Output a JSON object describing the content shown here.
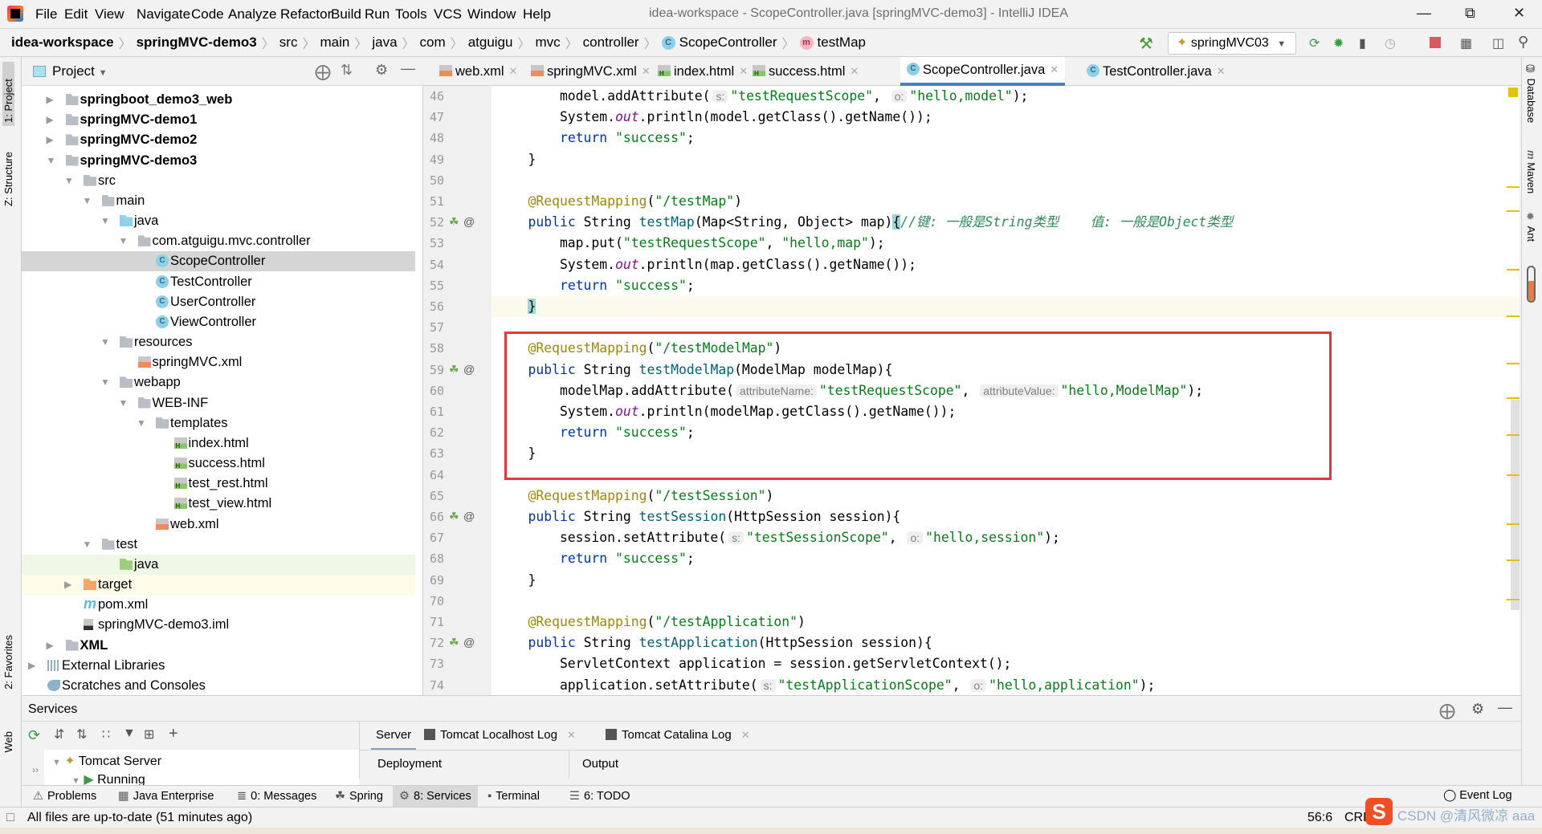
{
  "app": {
    "title": "idea-workspace - ScopeController.java [springMVC-demo3] - IntelliJ IDEA"
  },
  "menu": [
    "File",
    "Edit",
    "View",
    "Navigate",
    "Code",
    "Analyze",
    "Refactor",
    "Build",
    "Run",
    "Tools",
    "VCS",
    "Window",
    "Help"
  ],
  "breadcrumb": [
    "idea-workspace",
    "springMVC-demo3",
    "src",
    "main",
    "java",
    "com",
    "atguigu",
    "mvc",
    "controller",
    "ScopeController",
    "testMap"
  ],
  "run_config": "springMVC03",
  "project_panel": {
    "title": "Project",
    "tree": [
      {
        "label": "springboot_demo3_web",
        "depth": 1,
        "arrow": "collapsed",
        "icon": "module",
        "bold": true
      },
      {
        "label": "springMVC-demo1",
        "depth": 1,
        "arrow": "collapsed",
        "icon": "module",
        "bold": true
      },
      {
        "label": "springMVC-demo2",
        "depth": 1,
        "arrow": "collapsed",
        "icon": "module",
        "bold": true
      },
      {
        "label": "springMVC-demo3",
        "depth": 1,
        "arrow": "expanded",
        "icon": "module",
        "bold": true
      },
      {
        "label": "src",
        "depth": 2,
        "arrow": "expanded",
        "icon": "folder"
      },
      {
        "label": "main",
        "depth": 3,
        "arrow": "expanded",
        "icon": "folder"
      },
      {
        "label": "java",
        "depth": 4,
        "arrow": "expanded",
        "icon": "source-folder"
      },
      {
        "label": "com.atguigu.mvc.controller",
        "depth": 5,
        "arrow": "expanded",
        "icon": "package"
      },
      {
        "label": "ScopeController",
        "depth": 6,
        "icon": "class",
        "selected": true
      },
      {
        "label": "TestController",
        "depth": 6,
        "icon": "class"
      },
      {
        "label": "UserController",
        "depth": 6,
        "icon": "class"
      },
      {
        "label": "ViewController",
        "depth": 6,
        "icon": "class"
      },
      {
        "label": "resources",
        "depth": 4,
        "arrow": "expanded",
        "icon": "resources-folder"
      },
      {
        "label": "springMVC.xml",
        "depth": 5,
        "icon": "spring-xml"
      },
      {
        "label": "webapp",
        "depth": 4,
        "arrow": "expanded",
        "icon": "web-folder"
      },
      {
        "label": "WEB-INF",
        "depth": 5,
        "arrow": "expanded",
        "icon": "folder"
      },
      {
        "label": "templates",
        "depth": 6,
        "arrow": "expanded",
        "icon": "folder"
      },
      {
        "label": "index.html",
        "depth": 7,
        "icon": "html"
      },
      {
        "label": "success.html",
        "depth": 7,
        "icon": "html"
      },
      {
        "label": "test_rest.html",
        "depth": 7,
        "icon": "html"
      },
      {
        "label": "test_view.html",
        "depth": 7,
        "icon": "html"
      },
      {
        "label": "web.xml",
        "depth": 6,
        "icon": "xml"
      },
      {
        "label": "test",
        "depth": 3,
        "arrow": "expanded",
        "icon": "folder"
      },
      {
        "label": "java",
        "depth": 4,
        "icon": "test-folder",
        "highlight": "green"
      },
      {
        "label": "target",
        "depth": 2,
        "arrow": "collapsed",
        "icon": "excluded-folder",
        "highlight": "yellow"
      },
      {
        "label": "pom.xml",
        "depth": 2,
        "icon": "maven"
      },
      {
        "label": "springMVC-demo3.iml",
        "depth": 2,
        "icon": "iml"
      },
      {
        "label": "XML",
        "depth": 1,
        "arrow": "collapsed",
        "icon": "module",
        "bold": true
      },
      {
        "label": "External Libraries",
        "depth": 0,
        "arrow": "collapsed",
        "icon": "libraries"
      },
      {
        "label": "Scratches and Consoles",
        "depth": 0,
        "icon": "scratches"
      }
    ]
  },
  "left_strip": [
    "1: Project",
    "Z: Structure",
    "2: Favorites",
    "Web"
  ],
  "right_strip": [
    "Database",
    "Maven",
    "Ant"
  ],
  "editor_tabs": [
    {
      "label": "web.xml",
      "icon": "xml"
    },
    {
      "label": "springMVC.xml",
      "icon": "spring-xml"
    },
    {
      "label": "index.html",
      "icon": "html"
    },
    {
      "label": "success.html",
      "icon": "html"
    },
    {
      "label": "ScopeController.java",
      "icon": "class",
      "active": true
    },
    {
      "label": "TestController.java",
      "icon": "class"
    }
  ],
  "code": {
    "current_line": 56,
    "lines": [
      {
        "n": 46,
        "t": [
          [
            "        model.addAttribute(",
            ""
          ],
          [
            "s:",
            "hint"
          ],
          [
            "\"testRequestScope\"",
            "str"
          ],
          [
            ", ",
            ""
          ],
          [
            "o:",
            "hint"
          ],
          [
            "\"hello,model\"",
            "str"
          ],
          [
            ");",
            ""
          ]
        ]
      },
      {
        "n": 47,
        "t": [
          [
            "        System.",
            ""
          ],
          [
            "out",
            "fld"
          ],
          [
            ".println(model.getClass().getName());",
            ""
          ]
        ]
      },
      {
        "n": 48,
        "t": [
          [
            "        ",
            ""
          ],
          [
            "return ",
            "kw"
          ],
          [
            "\"success\"",
            "str"
          ],
          [
            ";",
            ""
          ]
        ]
      },
      {
        "n": 49,
        "t": [
          [
            "    }",
            ""
          ]
        ]
      },
      {
        "n": 50,
        "t": []
      },
      {
        "n": 51,
        "t": [
          [
            "    ",
            ""
          ],
          [
            "@RequestMapping",
            "ann"
          ],
          [
            "(",
            ""
          ],
          [
            "\"/testMap\"",
            "str"
          ],
          [
            ")",
            ""
          ]
        ]
      },
      {
        "n": 52,
        "g": true,
        "t": [
          [
            "    ",
            ""
          ],
          [
            "public ",
            "kw"
          ],
          [
            "String ",
            ""
          ],
          [
            "testMap",
            "fn"
          ],
          [
            "(Map<String, Object> map)",
            ""
          ],
          [
            "{",
            "brace"
          ],
          [
            "//键: 一般是String类型    值: 一般是Object类型",
            "cmtg"
          ]
        ]
      },
      {
        "n": 53,
        "t": [
          [
            "        map.put(",
            ""
          ],
          [
            "\"testRequestScope\"",
            "str"
          ],
          [
            ", ",
            ""
          ],
          [
            "\"hello,map\"",
            "str"
          ],
          [
            ");",
            ""
          ]
        ]
      },
      {
        "n": 54,
        "t": [
          [
            "        System.",
            ""
          ],
          [
            "out",
            "fld"
          ],
          [
            ".println(map.getClass().getName());",
            ""
          ]
        ]
      },
      {
        "n": 55,
        "t": [
          [
            "        ",
            ""
          ],
          [
            "return ",
            "kw"
          ],
          [
            "\"success\"",
            "str"
          ],
          [
            ";",
            ""
          ]
        ]
      },
      {
        "n": 56,
        "t": [
          [
            "    ",
            ""
          ],
          [
            "}",
            "brace"
          ]
        ]
      },
      {
        "n": 57,
        "t": []
      },
      {
        "n": 58,
        "t": [
          [
            "    ",
            ""
          ],
          [
            "@RequestMapping",
            "ann"
          ],
          [
            "(",
            ""
          ],
          [
            "\"/testModelMap\"",
            "str"
          ],
          [
            ")",
            ""
          ]
        ]
      },
      {
        "n": 59,
        "g": true,
        "t": [
          [
            "    ",
            ""
          ],
          [
            "public ",
            "kw"
          ],
          [
            "String ",
            ""
          ],
          [
            "testModelMap",
            "fn"
          ],
          [
            "(ModelMap modelMap){",
            ""
          ]
        ]
      },
      {
        "n": 60,
        "t": [
          [
            "        modelMap.addAttribute(",
            ""
          ],
          [
            "attributeName:",
            "hint"
          ],
          [
            "\"testRequestScope\"",
            "str"
          ],
          [
            ", ",
            ""
          ],
          [
            "attributeValue:",
            "hint"
          ],
          [
            "\"hello,ModelMap\"",
            "str"
          ],
          [
            ");",
            ""
          ]
        ]
      },
      {
        "n": 61,
        "t": [
          [
            "        System.",
            ""
          ],
          [
            "out",
            "fld"
          ],
          [
            ".println(modelMap.getClass().getName());",
            ""
          ]
        ]
      },
      {
        "n": 62,
        "t": [
          [
            "        ",
            ""
          ],
          [
            "return ",
            "kw"
          ],
          [
            "\"success\"",
            "str"
          ],
          [
            ";",
            ""
          ]
        ]
      },
      {
        "n": 63,
        "t": [
          [
            "    }",
            ""
          ]
        ]
      },
      {
        "n": 64,
        "t": []
      },
      {
        "n": 65,
        "t": [
          [
            "    ",
            ""
          ],
          [
            "@RequestMapping",
            "ann"
          ],
          [
            "(",
            ""
          ],
          [
            "\"/testSession\"",
            "str"
          ],
          [
            ")",
            ""
          ]
        ]
      },
      {
        "n": 66,
        "g": true,
        "t": [
          [
            "    ",
            ""
          ],
          [
            "public ",
            "kw"
          ],
          [
            "String ",
            ""
          ],
          [
            "testSession",
            "fn"
          ],
          [
            "(HttpSession session){",
            ""
          ]
        ]
      },
      {
        "n": 67,
        "t": [
          [
            "        session.setAttribute(",
            ""
          ],
          [
            "s:",
            "hint"
          ],
          [
            "\"testSessionScope\"",
            "str"
          ],
          [
            ", ",
            ""
          ],
          [
            "o:",
            "hint"
          ],
          [
            "\"hello,session\"",
            "str"
          ],
          [
            ");",
            ""
          ]
        ]
      },
      {
        "n": 68,
        "t": [
          [
            "        ",
            ""
          ],
          [
            "return ",
            "kw"
          ],
          [
            "\"success\"",
            "str"
          ],
          [
            ";",
            ""
          ]
        ]
      },
      {
        "n": 69,
        "t": [
          [
            "    }",
            ""
          ]
        ]
      },
      {
        "n": 70,
        "t": []
      },
      {
        "n": 71,
        "t": [
          [
            "    ",
            ""
          ],
          [
            "@RequestMapping",
            "ann"
          ],
          [
            "(",
            ""
          ],
          [
            "\"/testApplication\"",
            "str"
          ],
          [
            ")",
            ""
          ]
        ]
      },
      {
        "n": 72,
        "g": true,
        "t": [
          [
            "    ",
            ""
          ],
          [
            "public ",
            "kw"
          ],
          [
            "String ",
            ""
          ],
          [
            "testApplication",
            "fn"
          ],
          [
            "(HttpSession session){",
            ""
          ]
        ]
      },
      {
        "n": 73,
        "t": [
          [
            "        ServletContext application = session.getServletContext();",
            ""
          ]
        ]
      },
      {
        "n": 74,
        "t": [
          [
            "        application.setAttribute(",
            ""
          ],
          [
            "s:",
            "hint"
          ],
          [
            "\"testApplicationScope\"",
            "str"
          ],
          [
            ", ",
            ""
          ],
          [
            "o:",
            "hint"
          ],
          [
            "\"hello,application\"",
            "str"
          ],
          [
            ");",
            ""
          ]
        ]
      }
    ]
  },
  "services": {
    "title": "Services",
    "tree": [
      "Tomcat Server",
      "Running"
    ],
    "tabs": [
      {
        "label": "Server",
        "active": true
      },
      {
        "label": "Tomcat Localhost Log"
      },
      {
        "label": "Tomcat Catalina Log"
      }
    ],
    "columns": [
      "Deployment",
      "Output"
    ]
  },
  "tool_tabs": [
    {
      "label": "Problems",
      "icon": "warning"
    },
    {
      "label": "Java Enterprise",
      "icon": "java-ee"
    },
    {
      "label": "0: Messages",
      "icon": "messages"
    },
    {
      "label": "Spring",
      "icon": "spring"
    },
    {
      "label": "8: Services",
      "icon": "services",
      "active": true
    },
    {
      "label": "Terminal",
      "icon": "terminal"
    },
    {
      "label": "6: TODO",
      "icon": "todo"
    }
  ],
  "event_log": "Event Log",
  "status": {
    "message": "All files are up-to-date (51 minutes ago)",
    "position": "56:6",
    "line_sep": "CRL",
    "watermark": "CSDN @清风微凉 aaa"
  },
  "colors": {
    "accent": "#4083c9",
    "highlight_box": "#e8373a",
    "selection": "#d5d5d5"
  }
}
